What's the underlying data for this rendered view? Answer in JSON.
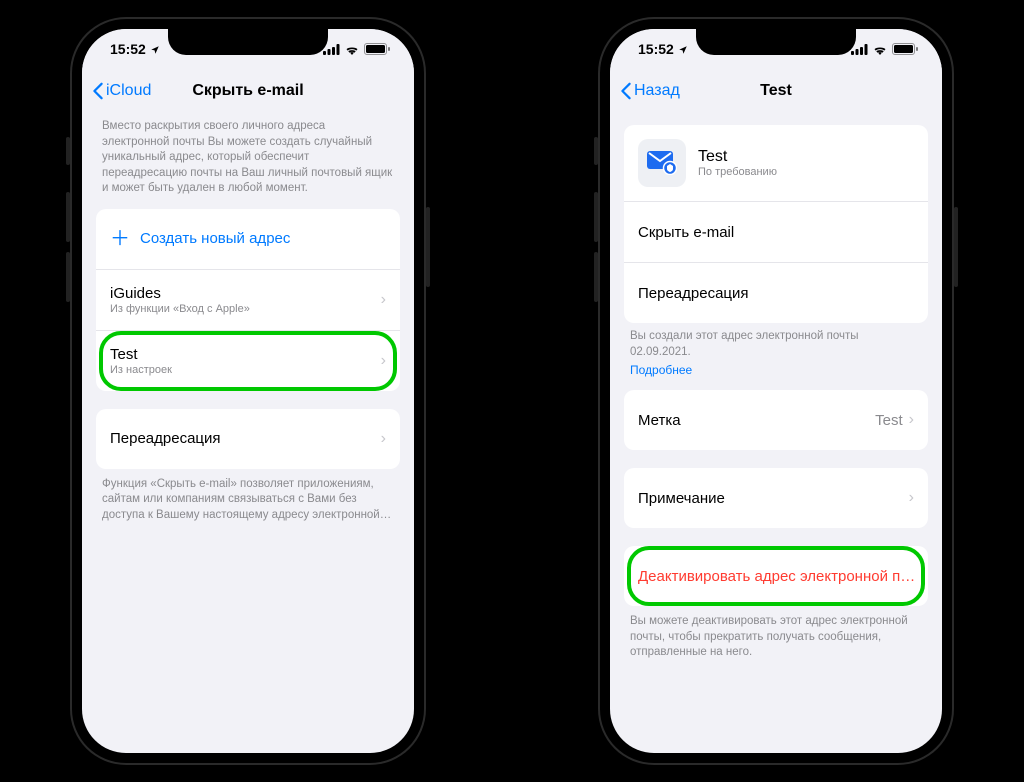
{
  "statusbar": {
    "time": "15:52"
  },
  "phone1": {
    "back": "iCloud",
    "title": "Скрыть e-mail",
    "intro": "Вместо раскрытия своего личного адреса электронной почты Вы можете создать случайный уникальный адрес, который обеспечит переадресацию почты на Ваш личный почтовый ящик и может быть удален в любой момент.",
    "create_label": "Создать новый адрес",
    "items": [
      {
        "title": "iGuides",
        "sub": "Из функции «Вход с Apple»"
      },
      {
        "title": "Test",
        "sub": "Из настроек"
      }
    ],
    "forward_label": "Переадресация",
    "footer": "Функция «Скрыть e-mail» позволяет приложениям, сайтам или компаниям связываться с Вами без доступа к Вашему настоящему адресу электронной…"
  },
  "phone2": {
    "back": "Назад",
    "title": "Test",
    "header": {
      "title": "Test",
      "sub": "По требованию"
    },
    "rows": {
      "hide": "Скрыть e-mail",
      "forward": "Переадресация",
      "label_name": "Метка",
      "label_value": "Test",
      "note": "Примечание",
      "deactivate": "Деактивировать адрес электронной п…"
    },
    "created_text": "Вы создали этот адрес электронной почты 02.09.2021.",
    "more": "Подробнее",
    "deactivate_footer": "Вы можете деактивировать этот адрес электронной почты, чтобы прекратить получать сообщения, отправленные на него."
  }
}
